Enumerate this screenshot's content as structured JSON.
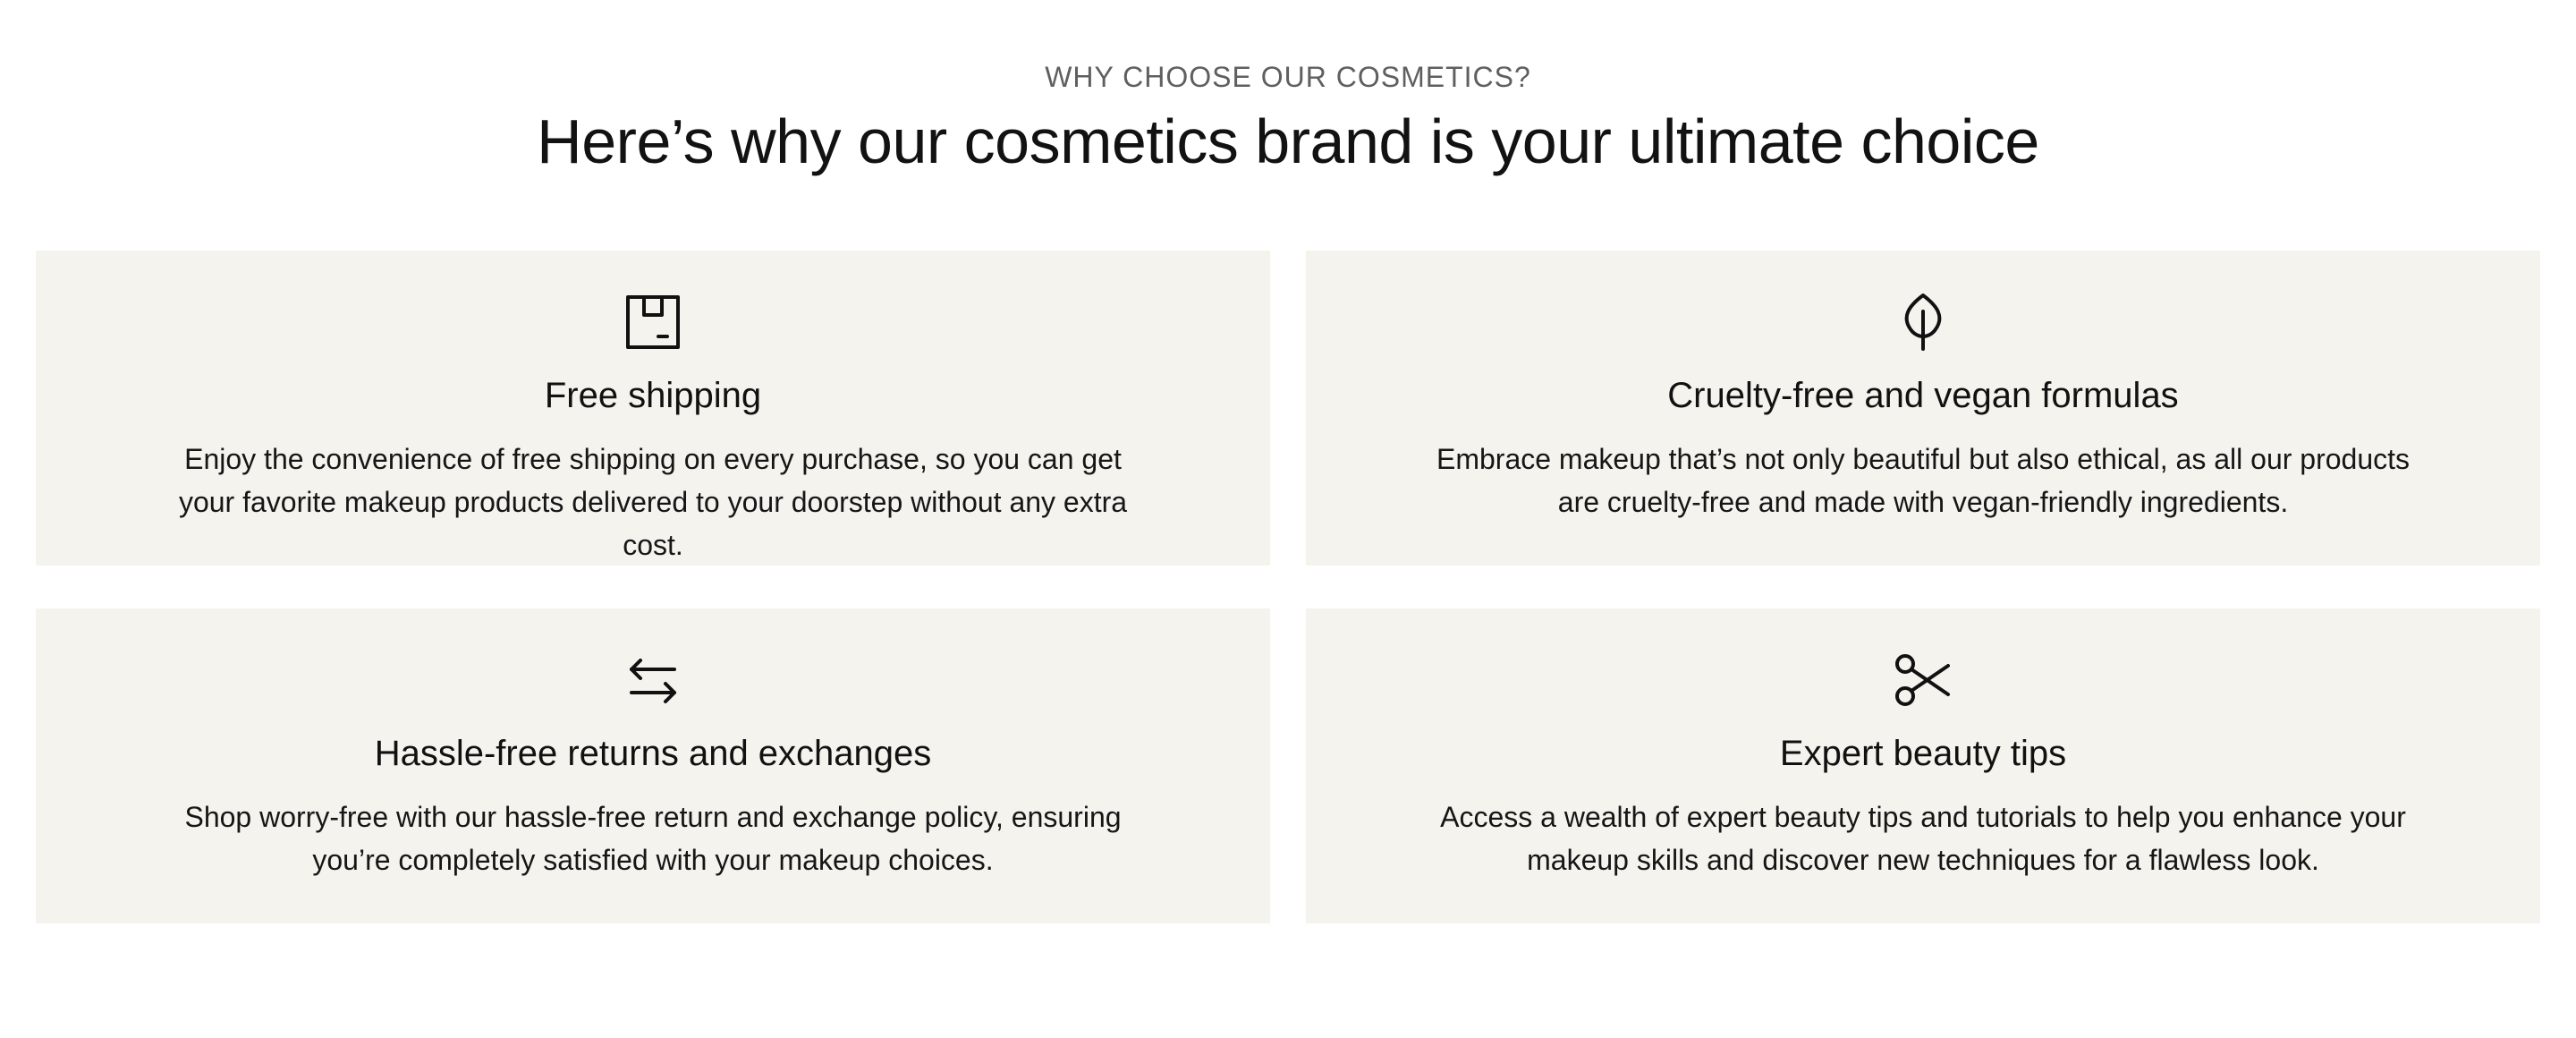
{
  "section": {
    "eyebrow": "WHY CHOOSE OUR COSMETICS?",
    "heading": "Here’s why our cosmetics brand is your ultimate choice"
  },
  "features": [
    {
      "icon": "package-box-icon",
      "title": "Free shipping",
      "text": "Enjoy the convenience of free shipping on every purchase, so you can get your favorite makeup products delivered to your doorstep without any extra cost."
    },
    {
      "icon": "leaf-icon",
      "title": "Cruelty-free and vegan formulas",
      "text": "Embrace makeup that’s not only beautiful but also ethical, as all our products are cruelty-free and made with vegan-friendly ingredients."
    },
    {
      "icon": "exchange-arrows-icon",
      "title": "Hassle-free returns and exchanges",
      "text": "Shop worry-free with our hassle-free return and exchange policy, ensuring you’re completely satisfied with your makeup choices."
    },
    {
      "icon": "scissors-icon",
      "title": "Expert beauty tips",
      "text": "Access a wealth of expert beauty tips and tutorials to help you enhance your makeup skills and discover new techniques for a flawless look."
    }
  ],
  "colors": {
    "card_background": "#f5f3ee",
    "eyebrow_text": "#5f5f5f",
    "heading_text": "#121212"
  }
}
